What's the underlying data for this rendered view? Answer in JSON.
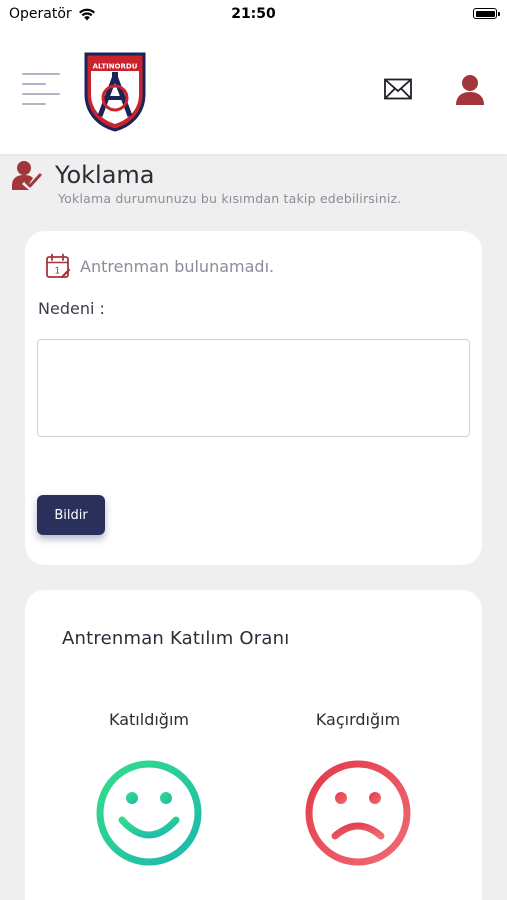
{
  "status_bar": {
    "carrier": "Operatör",
    "time": "21:50"
  },
  "header": {
    "logo_text": "ALTINORDU",
    "icons": [
      "menu-icon",
      "team-logo",
      "mail-icon",
      "user-icon"
    ]
  },
  "page": {
    "title": "Yoklama",
    "subtitle": "Yoklama durumunuzu bu kısımdan takip edebilirsiniz."
  },
  "attendance_card": {
    "no_training_text": "Antrenman bulunamadı.",
    "reason_label": "Nedeni :",
    "reason_value": "",
    "submit_label": "Bildir"
  },
  "stats_card": {
    "title": "Antrenman Katılım Oranı",
    "attended_label": "Katıldığım",
    "missed_label": "Kaçırdığım"
  },
  "colors": {
    "accent_red": "#a3363b",
    "button_navy": "#29305c",
    "smile_start": "#33dd88",
    "smile_end": "#1cb8b0",
    "sad_start": "#e33a4a",
    "sad_end": "#f06b73"
  }
}
